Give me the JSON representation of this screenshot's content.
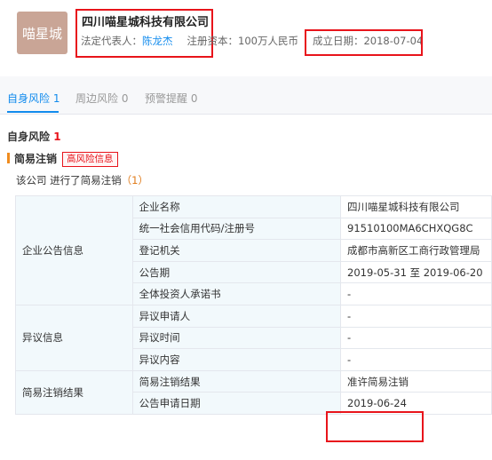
{
  "header": {
    "logo_text": "喵星城",
    "company_name": "四川喵星城科技有限公司",
    "legal_rep_label": "法定代表人：",
    "legal_rep_name": "陈龙杰",
    "reg_capital_label": "注册资本：",
    "reg_capital_value": "100万人民币",
    "established_label": "成立日期：",
    "established_value": "2018-07-04"
  },
  "tabs": [
    {
      "label": "自身风险",
      "count": "1"
    },
    {
      "label": "周边风险",
      "count": "0"
    },
    {
      "label": "预警提醒",
      "count": "0"
    }
  ],
  "section": {
    "title": "自身风险",
    "count": "1"
  },
  "subsection": {
    "title": "简易注销",
    "tag": "高风险信息",
    "desc_prefix": "该公司 进行了简易注销",
    "desc_count": "（1）"
  },
  "table": {
    "groups": [
      {
        "category": "企业公告信息",
        "rows": [
          {
            "label": "企业名称",
            "value": "四川喵星城科技有限公司"
          },
          {
            "label": "统一社会信用代码/注册号",
            "value": "91510100MA6CHXQG8C"
          },
          {
            "label": "登记机关",
            "value": "成都市高新区工商行政管理局"
          },
          {
            "label": "公告期",
            "value": "2019-05-31 至 2019-06-20"
          },
          {
            "label": "全体投资人承诺书",
            "value": "-"
          }
        ]
      },
      {
        "category": "异议信息",
        "rows": [
          {
            "label": "异议申请人",
            "value": "-"
          },
          {
            "label": "异议时间",
            "value": "-"
          },
          {
            "label": "异议内容",
            "value": "-"
          }
        ]
      },
      {
        "category": "简易注销结果",
        "rows": [
          {
            "label": "简易注销结果",
            "value": "准许简易注销"
          },
          {
            "label": "公告申请日期",
            "value": "2019-06-24"
          }
        ]
      }
    ]
  },
  "colors": {
    "accent": "#128bed",
    "highlight": "#e8141b",
    "logo_bg": "#c9a596"
  }
}
